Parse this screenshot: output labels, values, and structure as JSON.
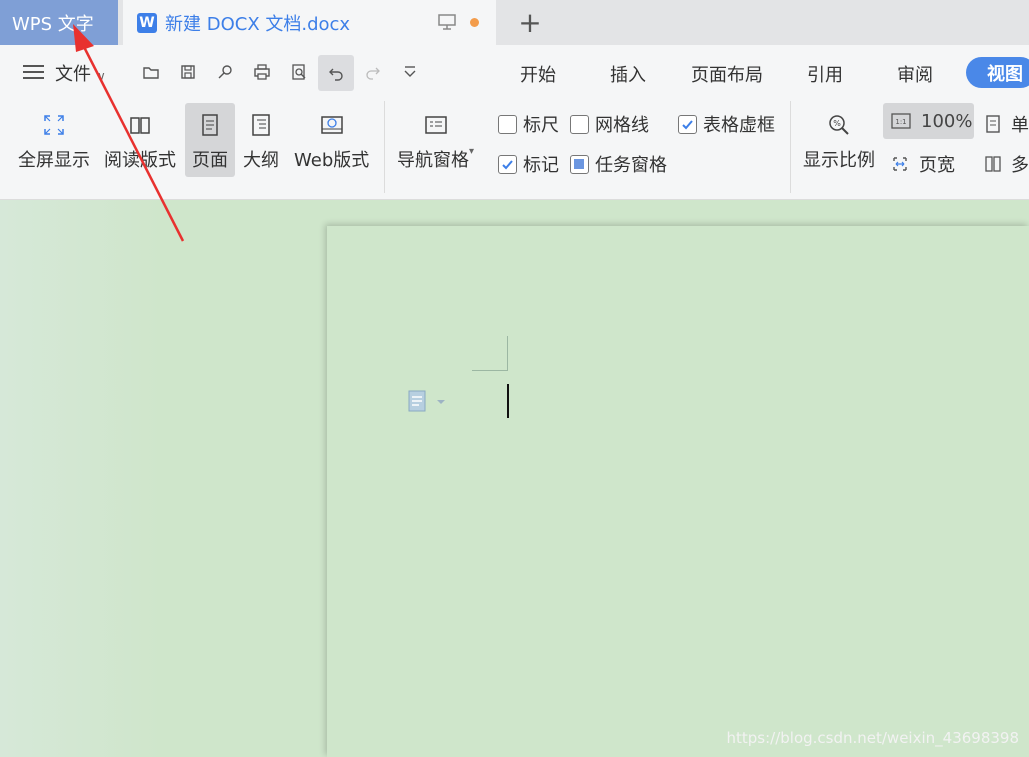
{
  "tabbar": {
    "app_tab": "WPS 文字",
    "doc_tab_title": "新建 DOCX 文档.docx",
    "doc_icon_letter": "W",
    "new_tab": "+"
  },
  "menu": {
    "file_label": "文件",
    "tabs": [
      "开始",
      "插入",
      "页面布局",
      "引用",
      "审阅",
      "视图"
    ],
    "active_tab": "视图"
  },
  "ribbon": {
    "buttons": [
      "全屏显示",
      "阅读版式",
      "页面",
      "大纲",
      "Web版式"
    ],
    "nav_pane": "导航窗格",
    "checks": {
      "ruler": {
        "label": "标尺",
        "checked": false
      },
      "gridlines": {
        "label": "网格线",
        "checked": false
      },
      "table_gridlines": {
        "label": "表格虚框",
        "checked": true
      },
      "marks": {
        "label": "标记",
        "checked": true
      },
      "task_pane": {
        "label": "任务窗格",
        "checked": "partial"
      }
    },
    "zoom_label": "显示比例",
    "zoom_value": "100%",
    "page_width": "页宽",
    "single_page": "单",
    "multi_page": "多"
  },
  "watermark": "https://blog.csdn.net/weixin_43698398",
  "colors": {
    "accent": "#4a88e8",
    "app_tab_bg": "#7f9fd6",
    "workspace": "#cfe6cb",
    "arrow": "#e8312f"
  }
}
